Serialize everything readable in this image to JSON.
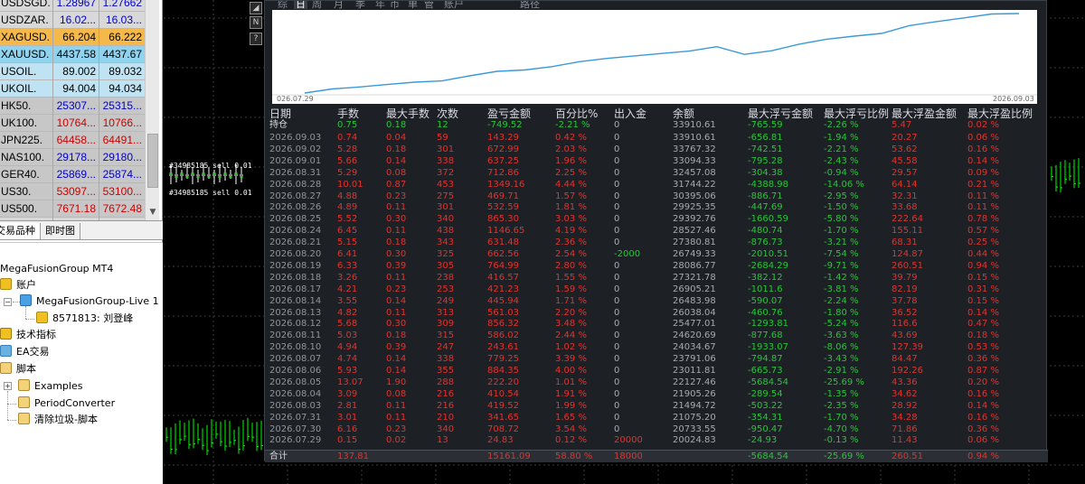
{
  "market_watch": {
    "rows": [
      {
        "symbol": "USDSGD.",
        "bid": "1.28967",
        "ask": "1.27662",
        "bid_color": "#0000cc",
        "ask_color": "#0000cc",
        "bg": "#d8d8d8"
      },
      {
        "symbol": "USDZAR.",
        "bid": "16.02...",
        "ask": "16.03...",
        "bid_color": "#0000cc",
        "ask_color": "#0000cc",
        "bg": "#d8d8d8"
      },
      {
        "symbol": "XAGUSD.",
        "bid": "66.204",
        "ask": "66.222",
        "bid_color": "#000000",
        "ask_color": "#000000",
        "bg": "#f5b84a"
      },
      {
        "symbol": "XAUUSD.",
        "bid": "4437.58",
        "ask": "4437.67",
        "bid_color": "#000000",
        "ask_color": "#000000",
        "bg": "#8fd3ef"
      },
      {
        "symbol": "USOIL.",
        "bid": "89.002",
        "ask": "89.032",
        "bid_color": "#000000",
        "ask_color": "#000000",
        "bg": "#bfe3f3"
      },
      {
        "symbol": "UKOIL.",
        "bid": "94.004",
        "ask": "94.034",
        "bid_color": "#000000",
        "ask_color": "#000000",
        "bg": "#bfe3f3"
      },
      {
        "symbol": "HK50.",
        "bid": "25307...",
        "ask": "25315...",
        "bid_color": "#0000cc",
        "ask_color": "#0000cc",
        "bg": "#c7c7c7"
      },
      {
        "symbol": "UK100.",
        "bid": "10764...",
        "ask": "10766...",
        "bid_color": "#cc0000",
        "ask_color": "#cc0000",
        "bg": "#c7c7c7"
      },
      {
        "symbol": "JPN225.",
        "bid": "64458...",
        "ask": "64491...",
        "bid_color": "#cc0000",
        "ask_color": "#cc0000",
        "bg": "#c7c7c7"
      },
      {
        "symbol": "NAS100.",
        "bid": "29178...",
        "ask": "29180...",
        "bid_color": "#0000cc",
        "ask_color": "#0000cc",
        "bg": "#c7c7c7"
      },
      {
        "symbol": "GER40.",
        "bid": "25869...",
        "ask": "25874...",
        "bid_color": "#0000cc",
        "ask_color": "#0000cc",
        "bg": "#c7c7c7"
      },
      {
        "symbol": "US30.",
        "bid": "53097...",
        "ask": "53100...",
        "bid_color": "#cc0000",
        "ask_color": "#cc0000",
        "bg": "#c7c7c7"
      },
      {
        "symbol": "US500.",
        "bid": "7671.18",
        "ask": "7672.48",
        "bid_color": "#cc0000",
        "ask_color": "#cc0000",
        "bg": "#c7c7c7"
      }
    ],
    "tabs": {
      "symbols": "交易品种",
      "tick": "即时图"
    }
  },
  "navigator": {
    "root": "MegaFusionGroup MT4",
    "accounts": "账户",
    "server": "MegaFusionGroup-Live 1",
    "account": "8571813: 刘登峰",
    "indicators": "技术指标",
    "experts": "EA交易",
    "scripts": "脚本",
    "script_items": [
      "Examples",
      "PeriodConverter",
      "清除垃圾-脚本"
    ]
  },
  "chart": {
    "order_label_1": "#34985185 sell 0.01",
    "order_label_2": "#34985185 sell 0.01"
  },
  "side_buttons": [
    "N",
    "?"
  ],
  "panel": {
    "tabs": [
      "综",
      "日",
      "周",
      "月",
      "季",
      "年",
      "币",
      "单",
      "管",
      "账户",
      "路径"
    ],
    "active_tab": 1,
    "curve": {
      "date_start": "026.07.29",
      "date_end": "2026.09.03",
      "line_color": "#3a9ad9",
      "balance": [
        20024.83,
        20733.55,
        21075.2,
        21494.72,
        21905.26,
        22127.46,
        23011.81,
        23791.06,
        24034.67,
        24620.69,
        25477.01,
        26038.04,
        26483.98,
        26905.21,
        27321.78,
        28086.77,
        26749.33,
        27380.81,
        28527.46,
        29392.76,
        29925.35,
        30395.06,
        31744.22,
        32457.08,
        33094.33,
        33767.32,
        33851.81
      ]
    },
    "headers": [
      "日期",
      "手数",
      "最大手数",
      "次数",
      "盈亏金额",
      "百分比%",
      "出入金",
      "余额",
      "最大浮亏金额",
      "最大浮亏比例",
      "最大浮盈金额",
      "最大浮盈比例"
    ],
    "holding": [
      "持仓",
      "0.75",
      "0.18",
      "12",
      "-749.52",
      "-2.21 %",
      "0",
      "33910.61",
      "-765.59",
      "-2.26 %",
      "5.47",
      "0.02 %"
    ],
    "rows": [
      [
        "2026.09.03",
        "0.74",
        "0.04",
        "59",
        "143.29",
        "0.42 %",
        "0",
        "33910.61",
        "-656.81",
        "-1.94 %",
        "20.27",
        "0.06 %"
      ],
      [
        "2026.09.02",
        "5.28",
        "0.18",
        "301",
        "672.99",
        "2.03 %",
        "0",
        "33767.32",
        "-742.51",
        "-2.21 %",
        "53.62",
        "0.16 %"
      ],
      [
        "2026.09.01",
        "5.66",
        "0.14",
        "338",
        "637.25",
        "1.96 %",
        "0",
        "33094.33",
        "-795.28",
        "-2.43 %",
        "45.58",
        "0.14 %"
      ],
      [
        "2026.08.31",
        "5.29",
        "0.08",
        "372",
        "712.86",
        "2.25 %",
        "0",
        "32457.08",
        "-304.38",
        "-0.94 %",
        "29.57",
        "0.09 %"
      ],
      [
        "2026.08.28",
        "10.01",
        "0.87",
        "453",
        "1349.16",
        "4.44 %",
        "0",
        "31744.22",
        "-4388.98",
        "-14.06 %",
        "64.14",
        "0.21 %"
      ],
      [
        "2026.08.27",
        "4.88",
        "0.23",
        "275",
        "469.71",
        "1.57 %",
        "0",
        "30395.06",
        "-886.71",
        "-2.95 %",
        "32.31",
        "0.11 %"
      ],
      [
        "2026.08.26",
        "4.89",
        "0.11",
        "301",
        "532.59",
        "1.81 %",
        "0",
        "29925.35",
        "-447.69",
        "-1.50 %",
        "33.68",
        "0.11 %"
      ],
      [
        "2026.08.25",
        "5.52",
        "0.30",
        "340",
        "865.30",
        "3.03 %",
        "0",
        "29392.76",
        "-1660.59",
        "-5.80 %",
        "222.64",
        "0.78 %"
      ],
      [
        "2026.08.24",
        "6.45",
        "0.11",
        "438",
        "1146.65",
        "4.19 %",
        "0",
        "28527.46",
        "-480.74",
        "-1.70 %",
        "155.11",
        "0.57 %"
      ],
      [
        "2026.08.21",
        "5.15",
        "0.18",
        "343",
        "631.48",
        "2.36 %",
        "0",
        "27380.81",
        "-876.73",
        "-3.21 %",
        "68.31",
        "0.25 %"
      ],
      [
        "2026.08.20",
        "6.41",
        "0.30",
        "325",
        "662.56",
        "2.54 %",
        "-2000",
        "26749.33",
        "-2010.51",
        "-7.54 %",
        "124.87",
        "0.44 %"
      ],
      [
        "2026.08.19",
        "6.33",
        "0.39",
        "305",
        "764.99",
        "2.80 %",
        "0",
        "28086.77",
        "-2684.29",
        "-9.71 %",
        "260.51",
        "0.94 %"
      ],
      [
        "2026.08.18",
        "3.26",
        "0.11",
        "238",
        "416.57",
        "1.55 %",
        "0",
        "27321.78",
        "-382.12",
        "-1.42 %",
        "39.79",
        "0.15 %"
      ],
      [
        "2026.08.17",
        "4.21",
        "0.23",
        "253",
        "421.23",
        "1.59 %",
        "0",
        "26905.21",
        "-1011.6",
        "-3.81 %",
        "82.19",
        "0.31 %"
      ],
      [
        "2026.08.14",
        "3.55",
        "0.14",
        "249",
        "445.94",
        "1.71 %",
        "0",
        "26483.98",
        "-590.07",
        "-2.24 %",
        "37.78",
        "0.15 %"
      ],
      [
        "2026.08.13",
        "4.82",
        "0.11",
        "313",
        "561.03",
        "2.20 %",
        "0",
        "26038.04",
        "-460.76",
        "-1.80 %",
        "36.52",
        "0.14 %"
      ],
      [
        "2026.08.12",
        "5.68",
        "0.30",
        "309",
        "856.32",
        "3.48 %",
        "0",
        "25477.01",
        "-1293.81",
        "-5.24 %",
        "116.6",
        "0.47 %"
      ],
      [
        "2026.08.11",
        "5.03",
        "0.18",
        "315",
        "586.02",
        "2.44 %",
        "0",
        "24620.69",
        "-877.68",
        "-3.63 %",
        "43.69",
        "0.18 %"
      ],
      [
        "2026.08.10",
        "4.94",
        "0.39",
        "247",
        "243.61",
        "1.02 %",
        "0",
        "24034.67",
        "-1933.07",
        "-8.06 %",
        "127.39",
        "0.53 %"
      ],
      [
        "2026.08.07",
        "4.74",
        "0.14",
        "338",
        "779.25",
        "3.39 %",
        "0",
        "23791.06",
        "-794.87",
        "-3.43 %",
        "84.47",
        "0.36 %"
      ],
      [
        "2026.08.06",
        "5.93",
        "0.14",
        "355",
        "884.35",
        "4.00 %",
        "0",
        "23011.81",
        "-665.73",
        "-2.91 %",
        "192.26",
        "0.87 %"
      ],
      [
        "2026.08.05",
        "13.07",
        "1.90",
        "288",
        "222.20",
        "1.01 %",
        "0",
        "22127.46",
        "-5684.54",
        "-25.69 %",
        "43.36",
        "0.20 %"
      ],
      [
        "2026.08.04",
        "3.09",
        "0.08",
        "216",
        "410.54",
        "1.91 %",
        "0",
        "21905.26",
        "-289.54",
        "-1.35 %",
        "34.62",
        "0.16 %"
      ],
      [
        "2026.08.03",
        "2.81",
        "0.11",
        "216",
        "419.52",
        "1.99 %",
        "0",
        "21494.72",
        "-503.22",
        "-2.35 %",
        "28.92",
        "0.14 %"
      ],
      [
        "2026.07.31",
        "3.01",
        "0.11",
        "210",
        "341.65",
        "1.65 %",
        "0",
        "21075.20",
        "-354.31",
        "-1.70 %",
        "34.28",
        "0.16 %"
      ],
      [
        "2026.07.30",
        "6.16",
        "0.23",
        "340",
        "708.72",
        "3.54 %",
        "0",
        "20733.55",
        "-950.47",
        "-4.70 %",
        "71.86",
        "0.36 %"
      ],
      [
        "2026.07.29",
        "0.15",
        "0.02",
        "13",
        "24.83",
        "0.12 %",
        "20000",
        "20024.83",
        "-24.93",
        "-0.13 %",
        "11.43",
        "0.06 %"
      ]
    ],
    "total": [
      "合计",
      "137.81",
      "",
      "",
      "15161.09",
      "58.80 %",
      "18000",
      "",
      "-5684.54",
      "-25.69 %",
      "260.51",
      "0.94 %"
    ]
  }
}
